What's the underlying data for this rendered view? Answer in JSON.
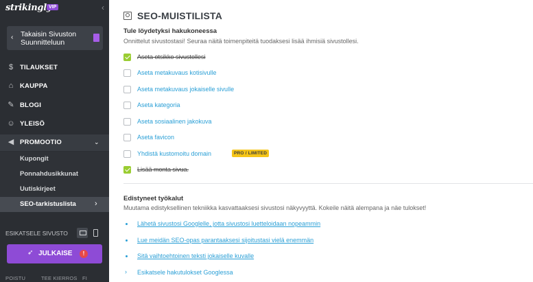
{
  "sidebar": {
    "logo": "strikingly",
    "vip_badge": "VIP",
    "back_label": "Takaisin Sivuston Suunnitteluun",
    "nav": [
      {
        "label": "TILAUKSET",
        "icon": "dollar-icon"
      },
      {
        "label": "KAUPPA",
        "icon": "store-icon"
      },
      {
        "label": "BLOGI",
        "icon": "pen-icon"
      },
      {
        "label": "YLEISÖ",
        "icon": "users-icon"
      },
      {
        "label": "PROMOOTIO",
        "icon": "megaphone-icon"
      }
    ],
    "promo_sub": [
      {
        "label": "Kupongit"
      },
      {
        "label": "Ponnahdusikkunat"
      },
      {
        "label": "Uutiskirjeet"
      },
      {
        "label": "SEO-tarkistuslista"
      }
    ],
    "preview_label": "ESIKATSELE SIVUSTO",
    "publish_label": "JULKAISE",
    "publish_alert": "!",
    "footer": [
      "POISTU",
      "TEE KIERROS",
      "FI"
    ]
  },
  "main": {
    "title": "SEO-MUISTILISTA",
    "found_title": "Tule löydetyksi hakukoneessa",
    "found_sub": "Onnittelut sivustostasi! Seuraa näitä toimenpiteitä tuodaksesi lisää ihmisiä sivustollesi.",
    "tasks": [
      {
        "label": "Aseta otsikko sivustollesi",
        "done": true
      },
      {
        "label": "Aseta metakuvaus kotisivulle",
        "done": false
      },
      {
        "label": "Aseta metakuvaus jokaiselle sivulle",
        "done": false
      },
      {
        "label": "Aseta kategoria",
        "done": false
      },
      {
        "label": "Aseta sosiaalinen jakokuva",
        "done": false
      },
      {
        "label": "Aseta favicon",
        "done": false
      },
      {
        "label": "Yhdistä kustomoitu domain",
        "done": false,
        "badge": "PRO / LIMITED"
      },
      {
        "label": "Lisää monta sivua.",
        "done": true
      }
    ],
    "tools_title": "Edistyneet työkalut",
    "tools_sub": "Muutama edistyksellinen tekniikka kasvattaaksesi sivustosi näkyvyyttä. Kokeile näitä alempana ja näe tulokset!",
    "tool_links": [
      "Lähetä sivustosi Googlelle, jotta sivustosi luetteloidaan nopeammin",
      "Lue meidän SEO-opas parantaaksesi sijoitustasi vielä enemmän",
      "Sitä vaihtoehtoinen teksti jokaiselle kuvalle",
      "Esikatsele hakutulokset Googlessa"
    ]
  },
  "colors": {
    "sidebar_bg": "#2b2e33",
    "accent_purple": "#8e4bd6",
    "link_blue": "#2a9fd6",
    "check_green": "#9acd32",
    "badge_yellow": "#f5c518"
  }
}
